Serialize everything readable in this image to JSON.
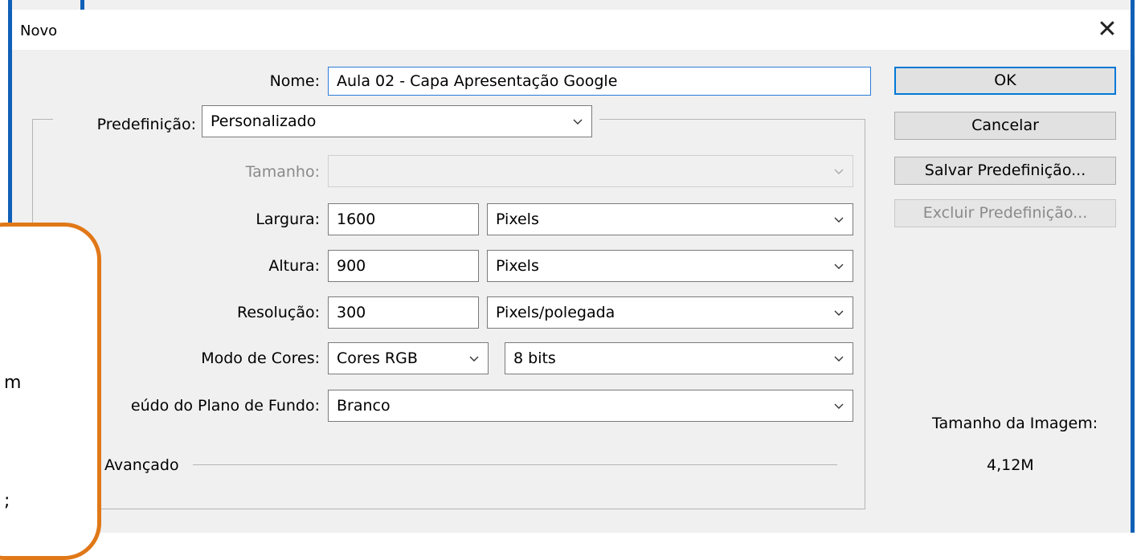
{
  "window": {
    "title": "Novo"
  },
  "form": {
    "nome_label": "Nome:",
    "nome_value": "Aula 02 - Capa Apresentação Google",
    "predefinicao_label": "Predefinição:",
    "predefinicao_value": "Personalizado",
    "tamanho_label": "Tamanho:",
    "tamanho_value": "",
    "largura_label": "Largura:",
    "largura_value": "1600",
    "largura_unit": "Pixels",
    "altura_label": "Altura:",
    "altura_value": "900",
    "altura_unit": "Pixels",
    "resolucao_label": "Resolução:",
    "resolucao_value": "300",
    "resolucao_unit": "Pixels/polegada",
    "modo_label": "Modo de Cores:",
    "modo_value": "Cores RGB",
    "bits_value": "8 bits",
    "fundo_label": "eúdo do Plano de Fundo:",
    "fundo_value": "Branco",
    "avancado_label": "Avançado"
  },
  "buttons": {
    "ok": "OK",
    "cancelar": "Cancelar",
    "salvar": "Salvar Predefinição...",
    "excluir": "Excluir Predefinição..."
  },
  "image_size": {
    "label": "Tamanho da Imagem:",
    "value": "4,12M"
  },
  "overlay": {
    "fragment_1": "m",
    "fragment_2": ";"
  },
  "colors": {
    "frame": "#1060b8",
    "callout_border": "#e07818",
    "focus": "#2a7bd6"
  }
}
